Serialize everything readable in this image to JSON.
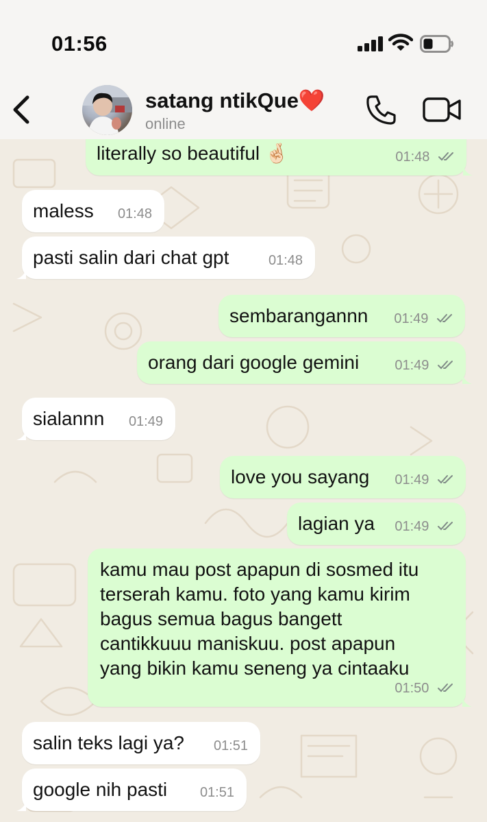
{
  "status_bar": {
    "time": "01:56"
  },
  "header": {
    "contact_name": "satang ntikQue❤️",
    "contact_status": "online"
  },
  "messages": [
    {
      "dir": "out",
      "text": "literally so beautiful 🤞🏻",
      "time": "01:48"
    },
    {
      "dir": "in",
      "text": "maless",
      "time": "01:48"
    },
    {
      "dir": "in",
      "text": "pasti salin dari chat gpt",
      "time": "01:48"
    },
    {
      "dir": "out",
      "text": "sembarangannn",
      "time": "01:49"
    },
    {
      "dir": "out",
      "text": "orang dari google gemini",
      "time": "01:49"
    },
    {
      "dir": "in",
      "text": "sialannn",
      "time": "01:49"
    },
    {
      "dir": "out",
      "text": "love you sayang",
      "time": "01:49"
    },
    {
      "dir": "out",
      "text": "lagian ya",
      "time": "01:49"
    },
    {
      "dir": "out",
      "lines": [
        "kamu mau post apapun di sosmed itu",
        "terserah kamu. foto yang kamu kirim",
        "bagus semua bagus bangett",
        "cantikkuuu maniskuu. post apapun",
        "yang bikin kamu seneng ya cintaaku"
      ],
      "time": "01:50"
    },
    {
      "dir": "in",
      "text": "salin teks lagi ya?",
      "time": "01:51"
    },
    {
      "dir": "in",
      "text": "google nih pasti",
      "time": "01:51"
    }
  ],
  "icons": {
    "back": "chevron-left-icon",
    "call": "phone-icon",
    "video": "video-camera-icon",
    "read_receipt": "double-check-icon"
  },
  "colors": {
    "outgoing_bubble": "#dbfdd2",
    "incoming_bubble": "#ffffff",
    "chat_background": "#f1ece3",
    "header_background": "#f6f5f3"
  }
}
